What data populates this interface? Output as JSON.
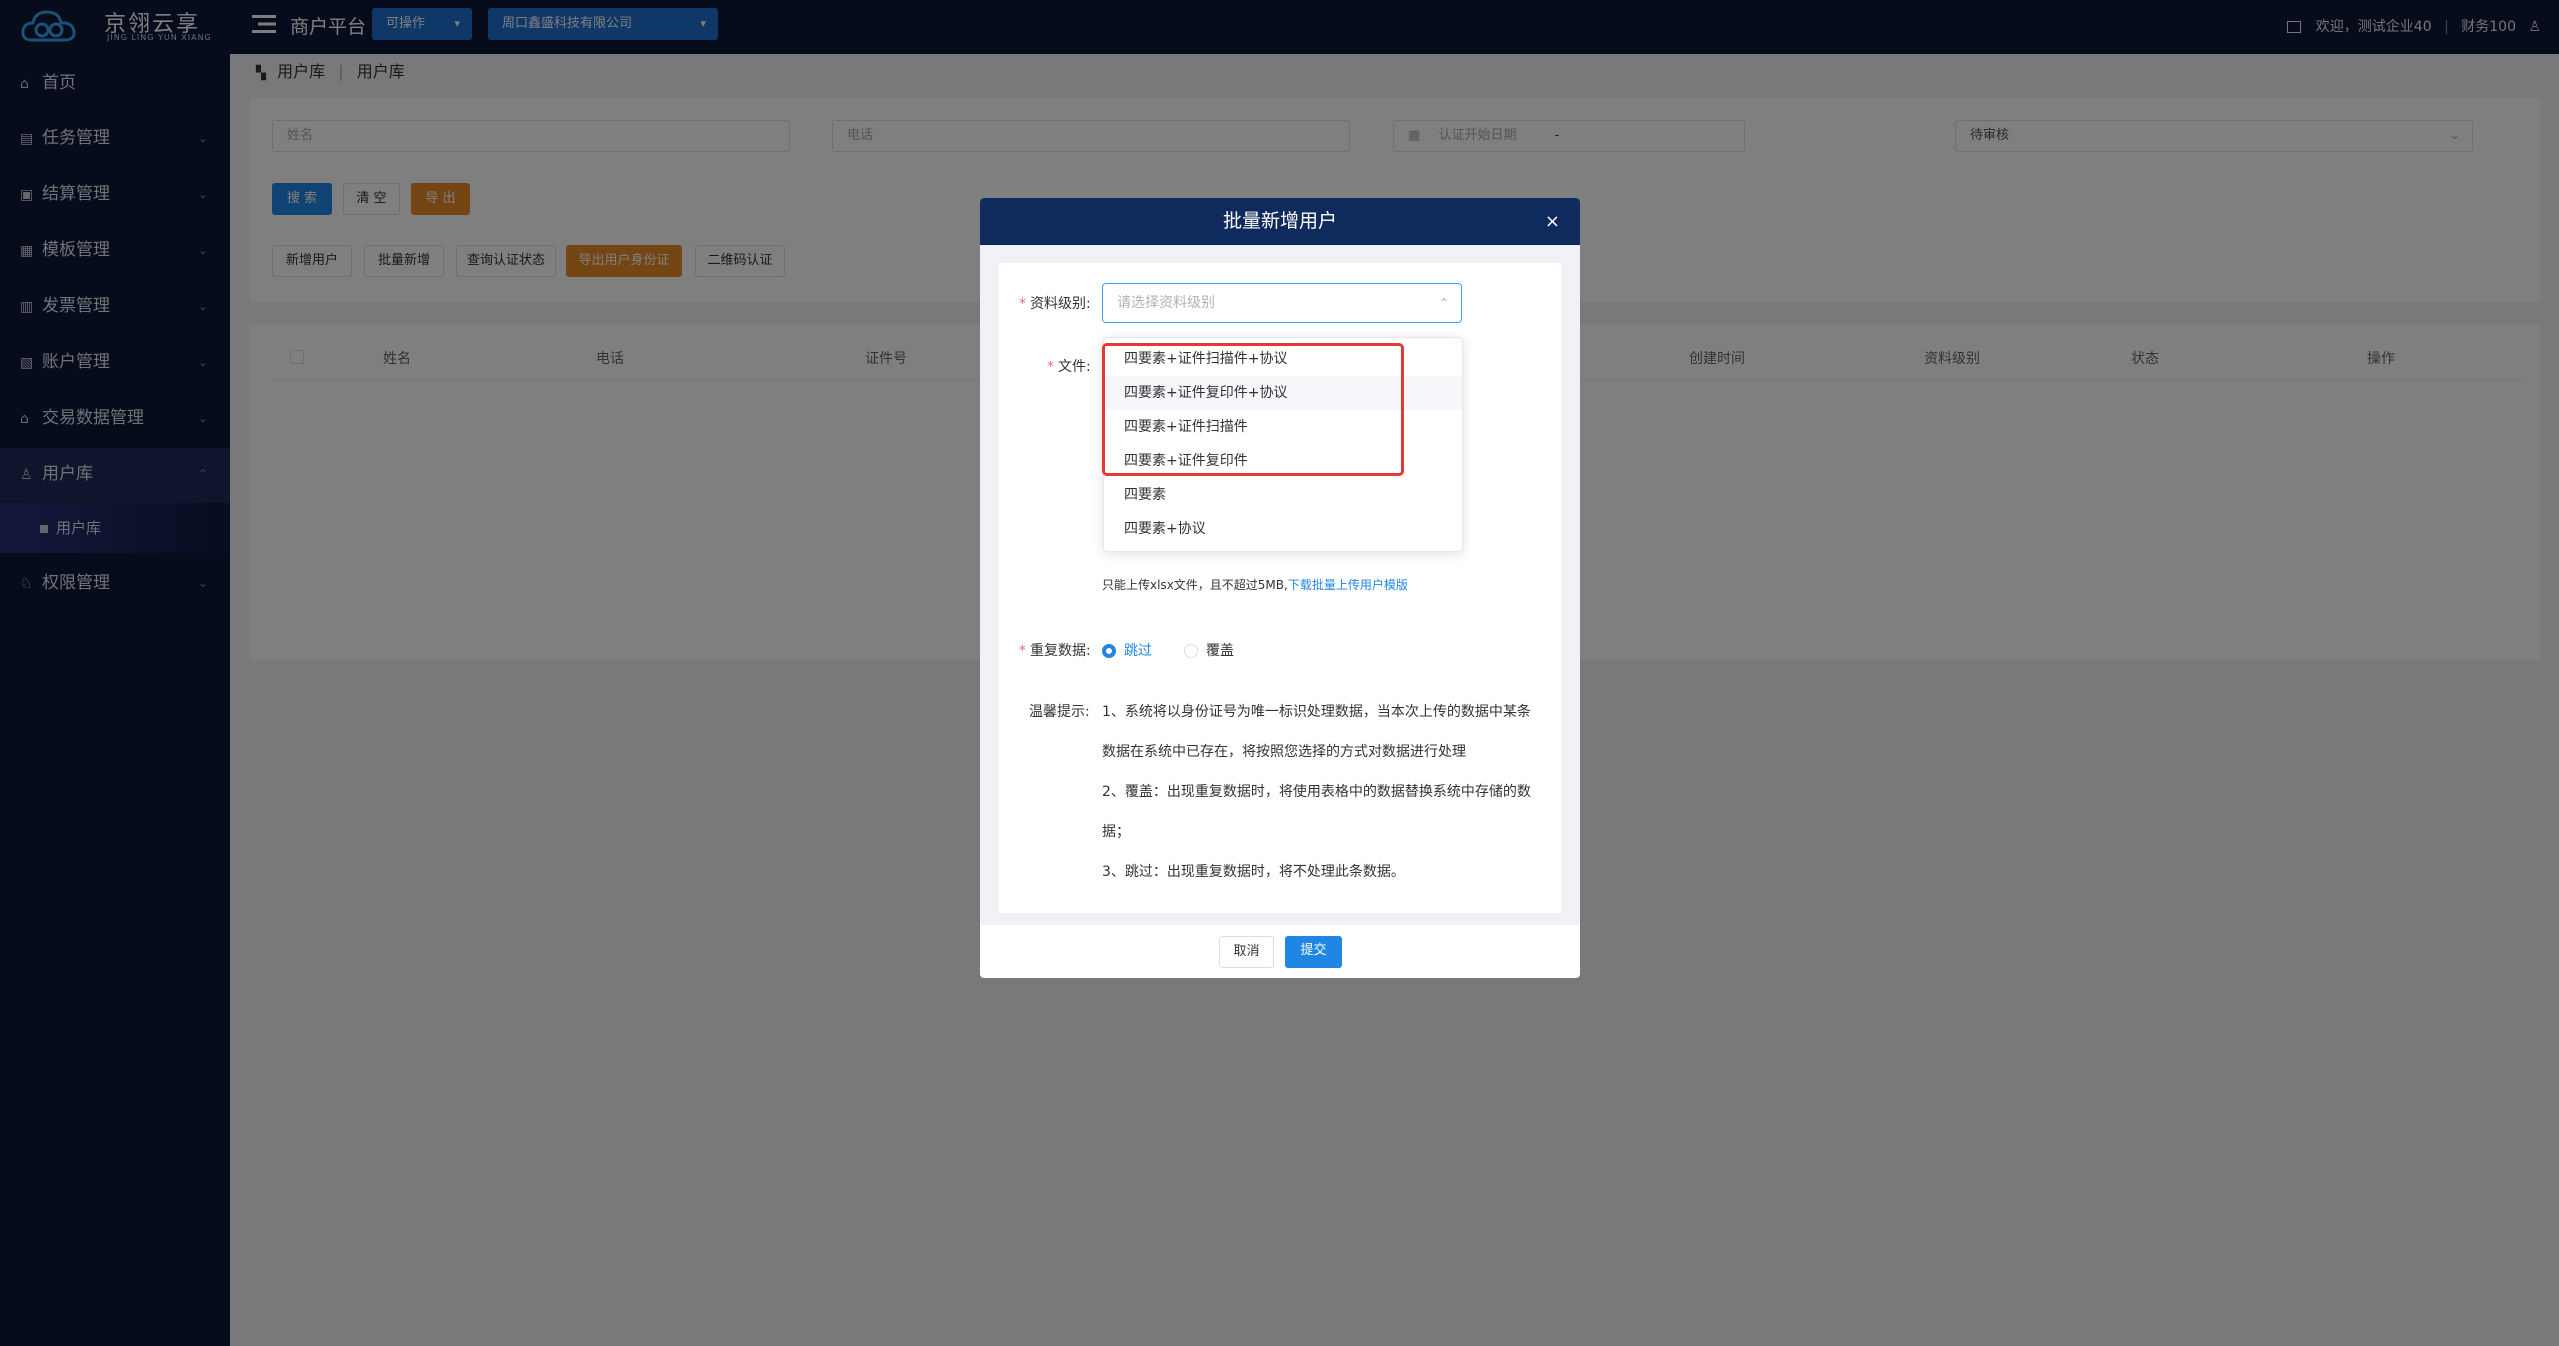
{
  "header": {
    "logo_cn": "京翎云享",
    "logo_en": "JING LING YUN XIANG",
    "platform_title": "商户平台",
    "mode_select": "可操作",
    "company_select": "周口鑫盛科技有限公司",
    "welcome": "欢迎，测试企业40",
    "user": "财务100"
  },
  "sidebar": {
    "items": [
      {
        "label": "首页",
        "icon": "home-icon"
      },
      {
        "label": "任务管理",
        "icon": "task-icon"
      },
      {
        "label": "结算管理",
        "icon": "settlement-icon"
      },
      {
        "label": "模板管理",
        "icon": "template-icon"
      },
      {
        "label": "发票管理",
        "icon": "invoice-icon"
      },
      {
        "label": "账户管理",
        "icon": "account-icon"
      },
      {
        "label": "交易数据管理",
        "icon": "bank-icon"
      },
      {
        "label": "用户库",
        "icon": "user-icon"
      },
      {
        "label": "权限管理",
        "icon": "permission-icon"
      }
    ],
    "submenu": "用户库"
  },
  "breadcrumb": [
    "用户库",
    "用户库"
  ],
  "filters": {
    "name_placeholder": "姓名",
    "phone_placeholder": "电话",
    "date_placeholder": "认证开始日期",
    "date_sep": "-",
    "status_value": "待审核"
  },
  "buttons": {
    "search": "搜 索",
    "clear": "清 空",
    "export": "导 出",
    "add_user": "新增用户",
    "batch_add": "批量新增",
    "query_auth": "查询认证状态",
    "export_id": "导出用户身份证",
    "qr_auth": "二维码认证"
  },
  "table": {
    "columns": [
      "姓名",
      "电话",
      "证件号",
      "创建时间",
      "资料级别",
      "状态",
      "操作"
    ]
  },
  "modal": {
    "title": "批量新增用户",
    "level_label": "资料级别:",
    "level_placeholder": "请选择资料级别",
    "file_label": "文件:",
    "upload_hint": "只能上传xlsx文件，且不超过5MB,",
    "upload_link": "下载批量上传用户模版",
    "dup_label": "重复数据:",
    "dup_options": [
      "跳过",
      "覆盖"
    ],
    "tip_label": "温馨提示:",
    "tips": [
      "1、系统将以身份证号为唯一标识处理数据，当本次上传的数据中某条",
      "数据在系统中已存在，将按照您选择的方式对数据进行处理",
      "2、覆盖：出现重复数据时，将使用表格中的数据替换系统中存储的数",
      "据；",
      "3、跳过：出现重复数据时，将不处理此条数据。"
    ],
    "cancel": "取消",
    "submit": "提交"
  },
  "dropdown": {
    "options": [
      "四要素+证件扫描件+协议",
      "四要素+证件复印件+协议",
      "四要素+证件扫描件",
      "四要素+证件复印件",
      "四要素",
      "四要素+协议"
    ]
  }
}
